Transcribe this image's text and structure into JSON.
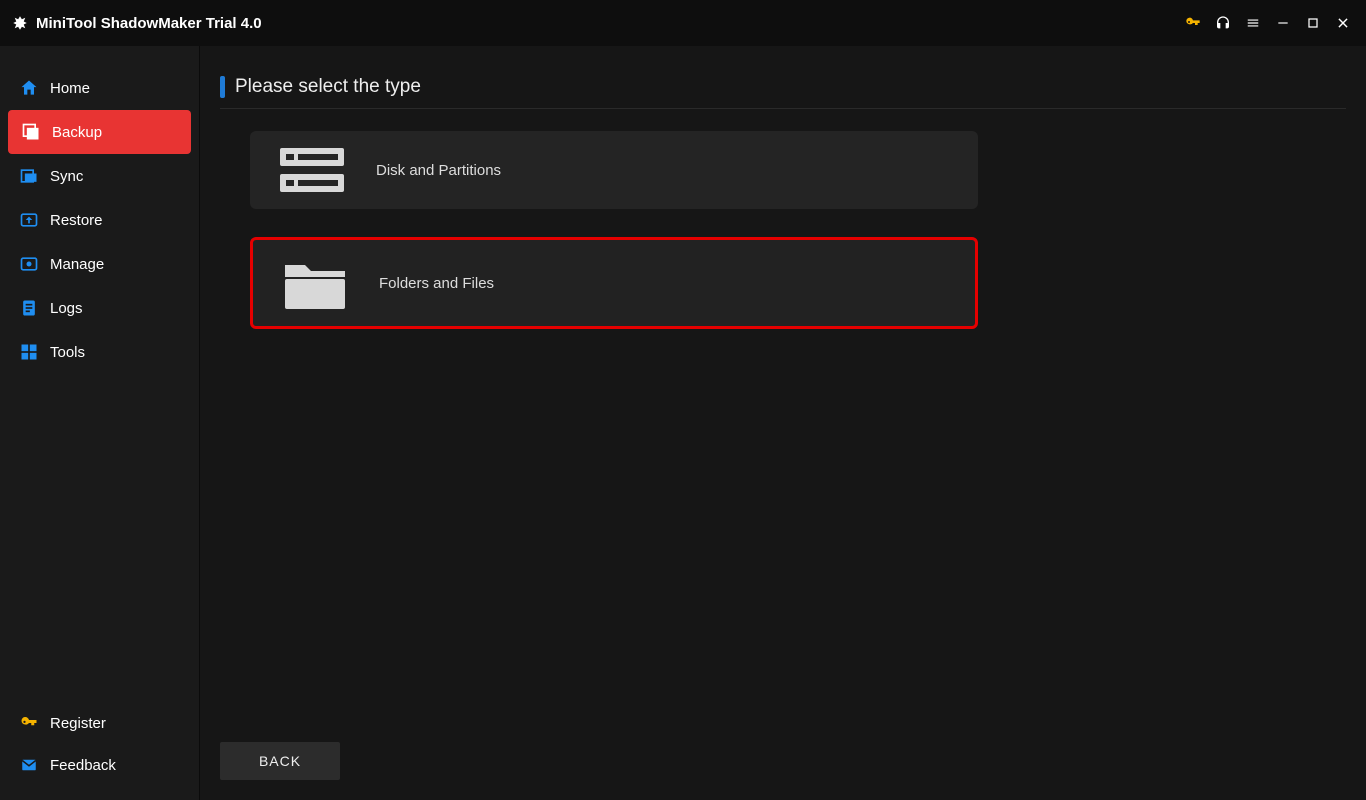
{
  "app": {
    "title": "MiniTool ShadowMaker Trial 4.0"
  },
  "sidebar": {
    "items": [
      {
        "label": "Home"
      },
      {
        "label": "Backup"
      },
      {
        "label": "Sync"
      },
      {
        "label": "Restore"
      },
      {
        "label": "Manage"
      },
      {
        "label": "Logs"
      },
      {
        "label": "Tools"
      }
    ],
    "bottom": [
      {
        "label": "Register"
      },
      {
        "label": "Feedback"
      }
    ]
  },
  "main": {
    "header": "Please select the type",
    "options": [
      {
        "label": "Disk and Partitions"
      },
      {
        "label": "Folders and Files"
      }
    ],
    "back_label": "BACK"
  },
  "colors": {
    "accent_red": "#e83433",
    "highlight_border": "#e50000",
    "header_bar": "#1f7bd6",
    "sidebar_blue": "#1f8ef1",
    "key_yellow": "#f5b300"
  }
}
